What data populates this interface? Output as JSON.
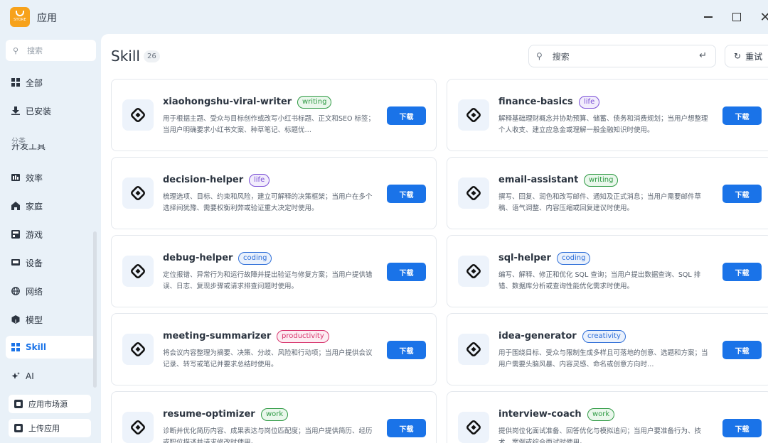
{
  "window": {
    "app_logo_text": "STORE",
    "title": "应用",
    "close_glyph": "✕"
  },
  "sidebar": {
    "search_placeholder": "搜索",
    "top_items": [
      {
        "label": "全部",
        "icon": "grid-icon"
      },
      {
        "label": "已安装",
        "icon": "download-icon"
      }
    ],
    "category_label": "分类",
    "cut_item_label": "开发工具",
    "categories": [
      {
        "label": "效率",
        "icon": "chart-icon"
      },
      {
        "label": "家庭",
        "icon": "home-icon"
      },
      {
        "label": "游戏",
        "icon": "game-icon"
      },
      {
        "label": "设备",
        "icon": "device-icon"
      },
      {
        "label": "网络",
        "icon": "globe-icon"
      },
      {
        "label": "模型",
        "icon": "cube-icon"
      },
      {
        "label": "Skill",
        "icon": "skill-icon",
        "active": true
      },
      {
        "label": "AI",
        "icon": "sparkle-icon"
      }
    ],
    "bottom_buttons": [
      {
        "label": "应用市场源",
        "icon": "source-icon"
      },
      {
        "label": "上传应用",
        "icon": "upload-icon"
      }
    ]
  },
  "main": {
    "title": "Skill",
    "count": "26",
    "search_placeholder": "搜索",
    "reset_label": "重试",
    "download_label": "下载",
    "cards": [
      {
        "name": "xiaohongshu-viral-writer",
        "tag": "writing",
        "desc": "用于根据主题、受众与目标创作或改写小红书标题、正文和SEO 标签；当用户明确要求小红书文案、种草笔记、标题优…"
      },
      {
        "name": "finance-basics",
        "tag": "life",
        "desc": "解释基础理财概念并协助预算、储蓄、债务和消费规划；当用户想整理个人收支、建立应急金或理解一般金融知识时使用。"
      },
      {
        "name": "decision-helper",
        "tag": "life",
        "desc": "梳理选项、目标、约束和风险，建立可解释的决策框架；当用户在多个选择间犹豫、需要权衡利弊或验证重大决定时使用。"
      },
      {
        "name": "email-assistant",
        "tag": "writing",
        "desc": "撰写、回复、润色和改写邮件、通知及正式消息；当用户需要邮件草稿、语气调整、内容压缩或回复建议时使用。"
      },
      {
        "name": "debug-helper",
        "tag": "coding",
        "desc": "定位报错、异常行为和运行故障并提出验证与修复方案；当用户提供错误、日志、复现步骤或请求排查问题时使用。"
      },
      {
        "name": "sql-helper",
        "tag": "coding",
        "desc": "编写、解释、修正和优化 SQL 查询；当用户提出数据查询、SQL 排错、数据库分析或查询性能优化需求时使用。"
      },
      {
        "name": "meeting-summarizer",
        "tag": "productivity",
        "desc": "将会议内容整理为摘要、决策、分歧、风险和行动项；当用户提供会议记录、转写或笔记并要求总结时使用。"
      },
      {
        "name": "idea-generator",
        "tag": "creativity",
        "desc": "用于围绕目标、受众与限制生成多样且可落地的创意、选题和方案；当用户需要头脑风暴、内容灵感、命名或创意方向时…"
      },
      {
        "name": "resume-optimizer",
        "tag": "work",
        "desc": "诊断并优化简历内容、成果表达与岗位匹配度；当用户提供简历、经历或职位描述并请求修改时使用。"
      },
      {
        "name": "interview-coach",
        "tag": "work",
        "desc": "提供岗位化面试准备、回答优化与模拟追问；当用户要准备行为、技术、案例或综合面试时使用。"
      }
    ]
  },
  "colors": {
    "accent": "#1a73e8",
    "background": "#e9f1f8",
    "logo": "#f7a21b"
  }
}
